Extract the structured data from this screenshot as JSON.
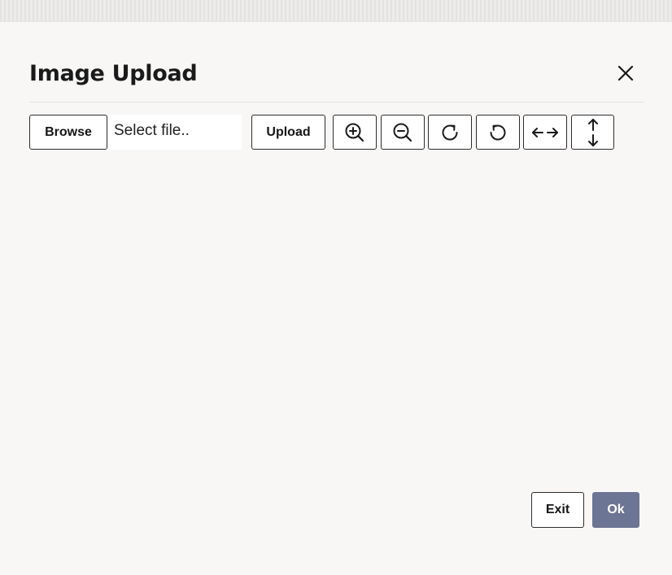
{
  "dialog": {
    "title": "Image Upload",
    "close_icon": "close-icon"
  },
  "toolbar": {
    "browse_label": "Browse",
    "file_placeholder": "Select file..",
    "upload_label": "Upload",
    "icons": [
      "zoom-in-icon",
      "zoom-out-icon",
      "rotate-clockwise-icon",
      "rotate-counterclockwise-icon",
      "horizontal-arrows-icon",
      "vertical-arrows-icon"
    ]
  },
  "footer": {
    "exit_label": "Exit",
    "ok_label": "Ok"
  },
  "colors": {
    "background": "#f9f7f6",
    "primary_button": "#6d7595",
    "border": "#2d2d2d"
  }
}
